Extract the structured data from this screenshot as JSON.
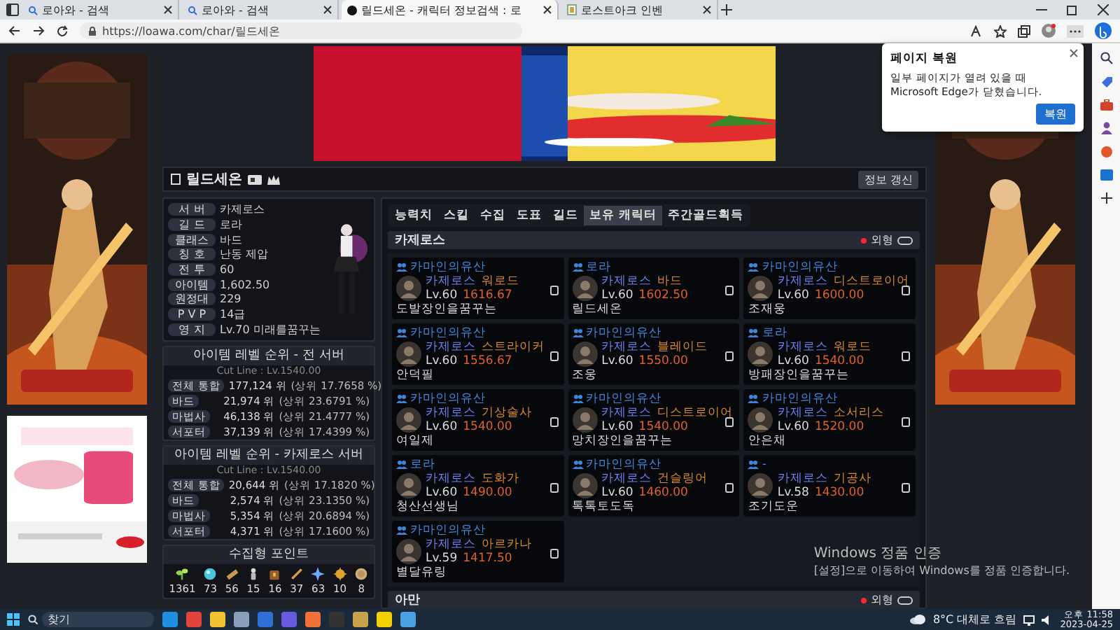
{
  "browser": {
    "tabs": [
      {
        "title": "로아와 - 검색",
        "selected": false
      },
      {
        "title": "로아와 - 검색",
        "selected": false
      },
      {
        "title": "릴드세온 - 캐릭터 정보검색 : 로",
        "selected": true
      },
      {
        "title": "로스트아크 인벤",
        "selected": false
      }
    ],
    "url": "https://loawa.com/char/릴드세온"
  },
  "character": {
    "name": "릴드세온",
    "refresh_button": "정보 갱신",
    "info": [
      {
        "label": "서 버",
        "value": "카제로스"
      },
      {
        "label": "길 드",
        "value": "로라"
      },
      {
        "label": "클래스",
        "value": "바드"
      },
      {
        "label": "칭 호",
        "value": "난동 제압"
      },
      {
        "label": "전 투",
        "value": "60"
      },
      {
        "label": "아이템",
        "value": "1,602.50"
      },
      {
        "label": "원정대",
        "value": "229"
      },
      {
        "label": "P V P",
        "value": "14급"
      },
      {
        "label": "영 지",
        "value": "Lv.70 미래를꿈꾸는"
      }
    ]
  },
  "rankings": [
    {
      "title": "아이템 레벨 순위 - 전 서버",
      "cut_line": "Cut Line : Lv.1540.00",
      "rows": [
        {
          "label": "전체 통합",
          "rank": "177,124 위",
          "share": "(상위 17.7658 %)"
        },
        {
          "label": "바드",
          "rank": "21,974 위",
          "share": "(상위 23.6791 %)"
        },
        {
          "label": "마법사",
          "rank": "46,138 위",
          "share": "(상위 21.4777 %)"
        },
        {
          "label": "서포터",
          "rank": "37,139 위",
          "share": "(상위 17.4399 %)"
        }
      ]
    },
    {
      "title": "아이템 레벨 순위 - 카제로스 서버",
      "cut_line": "Cut Line : Lv.1540.00",
      "rows": [
        {
          "label": "전체 통합",
          "rank": "20,644 위",
          "share": "(상위 17.1820 %)"
        },
        {
          "label": "바드",
          "rank": "2,574 위",
          "share": "(상위 23.1350 %)"
        },
        {
          "label": "마법사",
          "rank": "5,354 위",
          "share": "(상위 20.6894 %)"
        },
        {
          "label": "서포터",
          "rank": "4,371 위",
          "share": "(상위 17.1600 %)"
        }
      ]
    }
  ],
  "collection": {
    "title": "수집형 포인트",
    "points": [
      {
        "kind": "sprout",
        "value": "1361"
      },
      {
        "kind": "orb",
        "value": "73"
      },
      {
        "kind": "scroll",
        "value": "56"
      },
      {
        "kind": "figure",
        "value": "15"
      },
      {
        "kind": "chest",
        "value": "16"
      },
      {
        "kind": "wand",
        "value": "37"
      },
      {
        "kind": "star",
        "value": "63"
      },
      {
        "kind": "medal",
        "value": "10"
      },
      {
        "kind": "coin",
        "value": "8"
      }
    ]
  },
  "tabs": [
    {
      "label": "능력치",
      "selected": false
    },
    {
      "label": "스킬",
      "selected": false
    },
    {
      "label": "수집",
      "selected": false
    },
    {
      "label": "도표",
      "selected": false
    },
    {
      "label": "길드",
      "selected": false
    },
    {
      "label": "보유 캐릭터",
      "selected": true
    },
    {
      "label": "주간골드획득",
      "selected": false
    }
  ],
  "servers": [
    {
      "name": "카제로스",
      "appearance": {
        "label": "외형",
        "on": false
      },
      "characters": [
        {
          "guild": "카마인의유산",
          "server": "카제로스",
          "class": "워로드",
          "level": "Lv.60",
          "item_level": "1616.67",
          "name": "도발장인을꿈꾸는"
        },
        {
          "guild": "로라",
          "server": "카제로스",
          "class": "바드",
          "level": "Lv.60",
          "item_level": "1602.50",
          "name": "릴드세온"
        },
        {
          "guild": "카마인의유산",
          "server": "카제로스",
          "class": "디스트로이어",
          "level": "Lv.60",
          "item_level": "1600.00",
          "name": "조재웅"
        },
        {
          "guild": "카마인의유산",
          "server": "카제로스",
          "class": "스트라이커",
          "level": "Lv.60",
          "item_level": "1556.67",
          "name": "안덕필"
        },
        {
          "guild": "카마인의유산",
          "server": "카제로스",
          "class": "블레이드",
          "level": "Lv.60",
          "item_level": "1550.00",
          "name": "조웅"
        },
        {
          "guild": "로라",
          "server": "카제로스",
          "class": "워로드",
          "level": "Lv.60",
          "item_level": "1540.00",
          "name": "방패장인을꿈꾸는"
        },
        {
          "guild": "카마인의유산",
          "server": "카제로스",
          "class": "기상술사",
          "level": "Lv.60",
          "item_level": "1540.00",
          "name": "여일제"
        },
        {
          "guild": "카마인의유산",
          "server": "카제로스",
          "class": "디스트로이어",
          "level": "Lv.60",
          "item_level": "1540.00",
          "name": "망치장인을꿈꾸는"
        },
        {
          "guild": "카마인의유산",
          "server": "카제로스",
          "class": "소서리스",
          "level": "Lv.60",
          "item_level": "1520.00",
          "name": "안은채"
        },
        {
          "guild": "로라",
          "server": "카제로스",
          "class": "도화가",
          "level": "Lv.60",
          "item_level": "1490.00",
          "name": "청산선생님"
        },
        {
          "guild": "카마인의유산",
          "server": "카제로스",
          "class": "건슬링어",
          "level": "Lv.60",
          "item_level": "1460.00",
          "name": "톡톡토도독"
        },
        {
          "guild": "-",
          "server": "카제로스",
          "class": "기공사",
          "level": "Lv.58",
          "item_level": "1430.00",
          "name": "조기도운"
        },
        {
          "guild": "카마인의유산",
          "server": "카제로스",
          "class": "아르카나",
          "level": "Lv.59",
          "item_level": "1417.50",
          "name": "별달유링"
        }
      ]
    },
    {
      "name": "아만",
      "appearance": {
        "label": "외형",
        "on": false
      }
    }
  ],
  "restore_popup": {
    "title": "페이지 복원",
    "message": "일부 페이지가 열려 있을 때 Microsoft Edge가 닫혔습니다.",
    "button": "복원"
  },
  "activation_notice": {
    "title": "Windows 정품 인증",
    "message": "[설정]으로 이동하여 Windows를 정품 인증합니다."
  },
  "taskbar": {
    "search_placeholder": "찾기",
    "weather": "8°C 대체로 흐림",
    "time": "오후 11:58",
    "date": "2023-04-25"
  }
}
